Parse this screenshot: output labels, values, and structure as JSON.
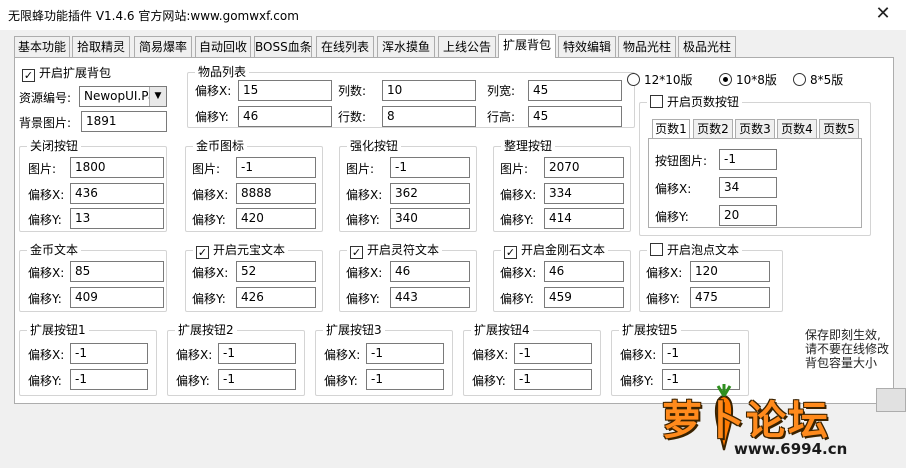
{
  "window": {
    "title": "无限蜂功能插件 V1.4.6  官方网站:www.gomwxf.com",
    "close_glyph": "✕"
  },
  "tabs": [
    {
      "label": "基本功能"
    },
    {
      "label": "拾取精灵"
    },
    {
      "label": "简易爆率"
    },
    {
      "label": "自动回收"
    },
    {
      "label": "BOSS血条"
    },
    {
      "label": "在线列表"
    },
    {
      "label": "浑水摸鱼"
    },
    {
      "label": "上线公告"
    },
    {
      "label": "扩展背包"
    },
    {
      "label": "特效编辑"
    },
    {
      "label": "物品光柱"
    },
    {
      "label": "极品光柱"
    }
  ],
  "active_tab": "扩展背包",
  "basic": {
    "enable_label": "开启扩展背包",
    "enable_checked": true,
    "resource_label": "资源编号:",
    "resource_value": "NewopUI.Pak",
    "bg_label": "背景图片:",
    "bg_value": "1891"
  },
  "item_list": {
    "title": "物品列表",
    "offset_x_label": "偏移X:",
    "offset_x": "15",
    "offset_y_label": "偏移Y:",
    "offset_y": "46",
    "cols_label": "列数:",
    "cols": "10",
    "rows_label": "行数:",
    "rows": "8",
    "col_width_label": "列宽:",
    "col_width": "45",
    "row_height_label": "行高:",
    "row_height": "45"
  },
  "layout_options": [
    {
      "label": "12*10版",
      "selected": false
    },
    {
      "label": "10*8版",
      "selected": true
    },
    {
      "label": "8*5版",
      "selected": false
    }
  ],
  "pages": {
    "enable_label": "开启页数按钮",
    "enable_checked": false,
    "tabs": [
      "页数1",
      "页数2",
      "页数3",
      "页数4",
      "页数5"
    ],
    "btn_image_label": "按钮图片:",
    "btn_image": "-1",
    "offset_x_label": "偏移X:",
    "offset_x": "34",
    "offset_y_label": "偏移Y:",
    "offset_y": "20"
  },
  "close_btn": {
    "title": "关闭按钮",
    "image_label": "图片:",
    "image": "1800",
    "offset_x_label": "偏移X:",
    "offset_x": "436",
    "offset_y_label": "偏移Y:",
    "offset_y": "13"
  },
  "gold_icon": {
    "title": "金币图标",
    "image_label": "图片:",
    "image": "-1",
    "offset_x_label": "偏移X:",
    "offset_x": "8888",
    "offset_y_label": "偏移Y:",
    "offset_y": "420"
  },
  "enhance_btn": {
    "title": "强化按钮",
    "image_label": "图片:",
    "image": "-1",
    "offset_x_label": "偏移X:",
    "offset_x": "362",
    "offset_y_label": "偏移Y:",
    "offset_y": "340"
  },
  "sort_btn": {
    "title": "整理按钮",
    "image_label": "图片:",
    "image": "2070",
    "offset_x_label": "偏移X:",
    "offset_x": "334",
    "offset_y_label": "偏移Y:",
    "offset_y": "414"
  },
  "gold_text": {
    "title": "金币文本",
    "offset_x_label": "偏移X:",
    "offset_x": "85",
    "offset_y_label": "偏移Y:",
    "offset_y": "409"
  },
  "yuanbao_text": {
    "title": "开启元宝文本",
    "checked": true,
    "offset_x_label": "偏移X:",
    "offset_x": "52",
    "offset_y_label": "偏移Y:",
    "offset_y": "426"
  },
  "lingfu_text": {
    "title": "开启灵符文本",
    "checked": true,
    "offset_x_label": "偏移X:",
    "offset_x": "46",
    "offset_y_label": "偏移Y:",
    "offset_y": "443"
  },
  "diamond_text": {
    "title": "开启金刚石文本",
    "checked": true,
    "offset_x_label": "偏移X:",
    "offset_x": "46",
    "offset_y_label": "偏移Y:",
    "offset_y": "459"
  },
  "bubble_text": {
    "title": "开启泡点文本",
    "checked": false,
    "offset_x_label": "偏移X:",
    "offset_x": "120",
    "offset_y_label": "偏移Y:",
    "offset_y": "475"
  },
  "expand_buttons": [
    {
      "title": "扩展按钮1",
      "offset_x_label": "偏移X:",
      "offset_x": "-1",
      "offset_y_label": "偏移Y:",
      "offset_y": "-1"
    },
    {
      "title": "扩展按钮2",
      "offset_x_label": "偏移X:",
      "offset_x": "-1",
      "offset_y_label": "偏移Y:",
      "offset_y": "-1"
    },
    {
      "title": "扩展按钮3",
      "offset_x_label": "偏移X:",
      "offset_x": "-1",
      "offset_y_label": "偏移Y:",
      "offset_y": "-1"
    },
    {
      "title": "扩展按钮4",
      "offset_x_label": "偏移X:",
      "offset_x": "-1",
      "offset_y_label": "偏移Y:",
      "offset_y": "-1"
    },
    {
      "title": "扩展按钮5",
      "offset_x_label": "偏移X:",
      "offset_x": "-1",
      "offset_y_label": "偏移Y:",
      "offset_y": "-1"
    }
  ],
  "note": {
    "line1": "保存即刻生效,",
    "line2": "请不要在线修改",
    "line3": "背包容量大小"
  },
  "watermark": {
    "text": "萝卜论坛",
    "url": "www.6994.cn"
  }
}
